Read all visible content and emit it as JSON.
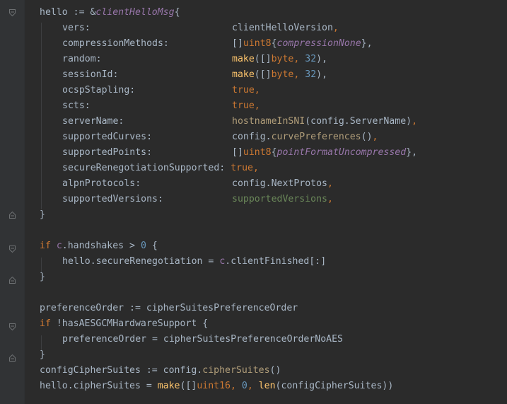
{
  "colors": {
    "background": "#2b2b2b",
    "gutter": "#313335",
    "text": "#a9b7c6",
    "keyword": "#cc7832",
    "function": "#ffc66d",
    "number": "#6897bb",
    "constant": "#9876aa",
    "variable_green": "#6a8759",
    "method": "#b09d79"
  },
  "fold_markers": [
    "fold-open-icon",
    "fold-close-icon"
  ],
  "code": {
    "l01": {
      "var": "hello",
      "op": " := &",
      "type": "clientHelloMsg",
      "brace": "{"
    },
    "fields": [
      {
        "name": "vers:",
        "v1": "clientHelloVersion",
        "v2": ","
      },
      {
        "name": "compressionMethods:",
        "v1": "[]",
        "v2": "uint8",
        "v3": "{",
        "v4": "compressionNone",
        "v5": "},"
      },
      {
        "name": "random:",
        "v1": "make",
        "v2": "([]",
        "v3": "byte",
        "v4": ", ",
        "v5": "32",
        "v6": "),"
      },
      {
        "name": "sessionId:",
        "v1": "make",
        "v2": "([]",
        "v3": "byte",
        "v4": ", ",
        "v5": "32",
        "v6": "),"
      },
      {
        "name": "ocspStapling:",
        "v1": "true",
        "v2": ","
      },
      {
        "name": "scts:",
        "v1": "true",
        "v2": ","
      },
      {
        "name": "serverName:",
        "v1": "hostnameInSNI",
        "v2": "(config.ServerName)",
        "v3": ","
      },
      {
        "name": "supportedCurves:",
        "v1": "config.",
        "v2": "curvePreferences",
        "v3": "()",
        "v4": ","
      },
      {
        "name": "supportedPoints:",
        "v1": "[]",
        "v2": "uint8",
        "v3": "{",
        "v4": "pointFormatUncompressed",
        "v5": "},"
      },
      {
        "name": "secureRenegotiationSupported:",
        "v1": "true",
        "v2": ","
      },
      {
        "name": "alpnProtocols:",
        "v1": "config.NextProtos",
        "v2": ","
      },
      {
        "name": "supportedVersions:",
        "v1": "supportedVersions",
        "v2": ","
      }
    ],
    "close_brace": "}",
    "if1": {
      "kw": "if",
      "recv": " c",
      "rest": ".handshakes > ",
      "num": "0",
      "brace": " {"
    },
    "assign1": {
      "lhs": "hello.secureRenegotiation = ",
      "recv": "c",
      "rhs": ".clientFinished[:]"
    },
    "pref": "preferenceOrder := cipherSuitesPreferenceOrder",
    "if2": {
      "kw": "if",
      "rest": " !hasAESGCMHardwareSupport {"
    },
    "assign2": "preferenceOrder = cipherSuitesPreferenceOrderNoAES",
    "ccs": {
      "a": "configCipherSuites := config.",
      "m": "cipherSuites",
      "b": "()"
    },
    "last": {
      "a": "hello.cipherSuites = ",
      "f1": "make",
      "b": "([]",
      "t": "uint16",
      "c": ", ",
      "n": "0",
      "d": ", ",
      "f2": "len",
      "e": "(configCipherSuites))"
    }
  }
}
